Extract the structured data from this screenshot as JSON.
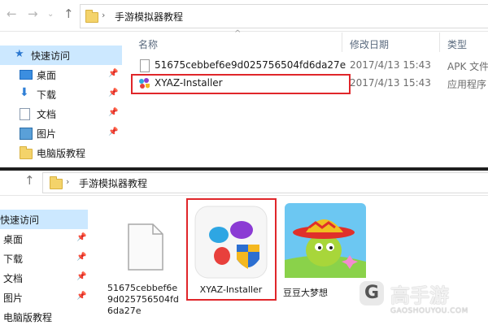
{
  "top_window": {
    "breadcrumb": "手游模拟器教程",
    "sidebar": {
      "items": [
        {
          "label": "快速访问",
          "icon": "star-icon",
          "selected": true
        },
        {
          "label": "桌面",
          "icon": "desktop-icon",
          "pinned": true
        },
        {
          "label": "下载",
          "icon": "download-icon",
          "pinned": true
        },
        {
          "label": "文档",
          "icon": "document-icon",
          "pinned": true
        },
        {
          "label": "图片",
          "icon": "picture-icon",
          "pinned": true
        },
        {
          "label": "电脑版教程",
          "icon": "folder-icon",
          "pinned": false
        }
      ]
    },
    "columns": {
      "name": "名称",
      "date": "修改日期",
      "type": "类型"
    },
    "files": [
      {
        "name": "51675cebbef6e9d025756504fd6da27e",
        "date": "2017/4/13 15:43",
        "type": "APK 文件",
        "icon": "blank-file-icon"
      },
      {
        "name": "XYAZ-Installer",
        "date": "2017/4/13 15:43",
        "type": "应用程序",
        "icon": "xyaz-app-icon"
      }
    ]
  },
  "bottom_window": {
    "breadcrumb": "手游模拟器教程",
    "sidebar": {
      "items": [
        {
          "label": "快速访问",
          "selected": true
        },
        {
          "label": "桌面",
          "pinned": true
        },
        {
          "label": "下载",
          "pinned": true
        },
        {
          "label": "文档",
          "pinned": true
        },
        {
          "label": "图片",
          "pinned": true
        },
        {
          "label": "电脑版教程",
          "pinned": false
        }
      ]
    },
    "tiles": [
      {
        "label_lines": [
          "51675cebbef6e",
          "9d025756504fd",
          "6da27e"
        ],
        "icon": "blank-file-icon"
      },
      {
        "label_lines": [
          "XYAZ-Installer"
        ],
        "icon": "xyaz-installer-icon"
      },
      {
        "label_lines": [
          "豆豆大梦想"
        ],
        "icon": "game-bean-icon"
      }
    ]
  },
  "watermark": {
    "brand": "高手游",
    "url": "GAOSHOUYOU.COM",
    "logo": "G"
  },
  "colors": {
    "highlight": "#e0262a",
    "selection": "#cce8ff",
    "folder": "#f4d36a"
  }
}
